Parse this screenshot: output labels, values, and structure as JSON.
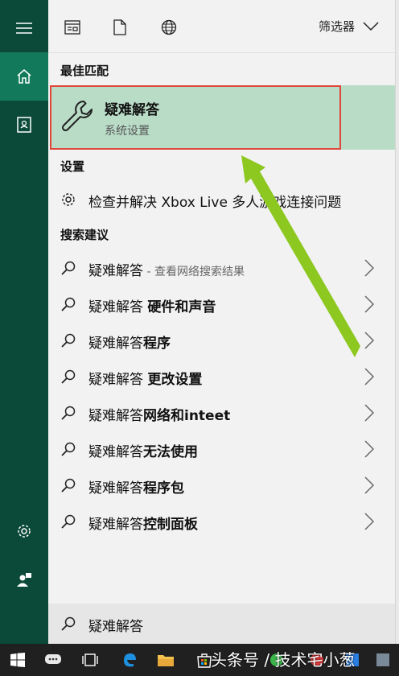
{
  "toolbar": {
    "filter_label": "筛选器"
  },
  "best_match": {
    "section_label": "最佳匹配",
    "title": "疑难解答",
    "subtitle": "系统设置"
  },
  "settings": {
    "section_label": "设置",
    "item": "检查并解决 Xbox Live 多人游戏连接问题"
  },
  "suggestions": {
    "section_label": "搜索建议",
    "items": [
      {
        "prefix": "疑难解答",
        "suffix": "",
        "hint": " - 查看网络搜索结果"
      },
      {
        "prefix": "疑难解答 ",
        "suffix": "硬件和声音",
        "hint": ""
      },
      {
        "prefix": "疑难解答",
        "suffix": "程序",
        "hint": ""
      },
      {
        "prefix": "疑难解答 ",
        "suffix": "更改设置",
        "hint": ""
      },
      {
        "prefix": "疑难解答",
        "suffix": "网络和inteet",
        "hint": ""
      },
      {
        "prefix": "疑难解答",
        "suffix": "无法使用",
        "hint": ""
      },
      {
        "prefix": "疑难解答",
        "suffix": "程序包",
        "hint": ""
      },
      {
        "prefix": "疑难解答",
        "suffix": "控制面板",
        "hint": ""
      }
    ]
  },
  "search": {
    "value": "疑难解答"
  },
  "watermark": "头条号 / 技术宅小葱",
  "colors": {
    "rail": "#0b4a38",
    "rail_active": "#127a5a",
    "best_match_bg": "#b9dcc7",
    "highlight_border": "#e0453a",
    "arrow": "#8cc820"
  }
}
